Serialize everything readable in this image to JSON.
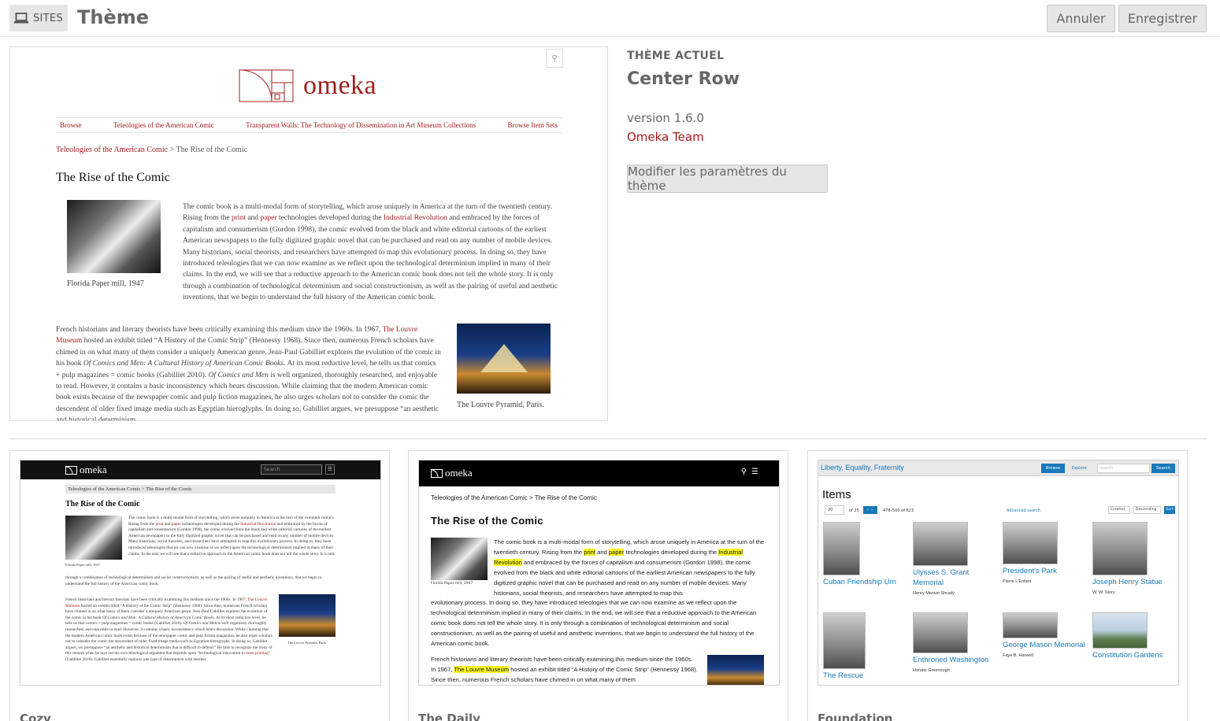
{
  "header": {
    "sites_label": "SITES",
    "title": "Thème",
    "cancel_label": "Annuler",
    "save_label": "Enregistrer"
  },
  "current_theme": {
    "section_label": "THÈME ACTUEL",
    "name": "Center Row",
    "version": "version 1.6.0",
    "author": "Omeka Team",
    "configure_label": "Modifier les paramètres du thème",
    "preview": {
      "logo_text": "omeka",
      "nav": [
        "Browse",
        "Teleologies of the American Comic",
        "Transparent Walls: The Technology of Dissemination in Art Museum Collections",
        "Browse Item Sets"
      ],
      "breadcrumb_link": "Teleologies of the American Comic",
      "breadcrumb_rest": " > The Rise of the Comic",
      "heading": "The Rise of the Comic",
      "caption1": "Florida Paper mill, 1947",
      "caption2": "The Louvre Pyramid, Paris."
    }
  },
  "themes": [
    {
      "name": "Cozy",
      "logo": "omeka",
      "search_placeholder": "Search",
      "breadcrumb": "Teleologies of the American Comic > The Rise of the Comic",
      "heading": "The Rise of the Comic",
      "caption1": "Florida Paper mill, 1947",
      "caption2": "The Louvre Pyramid, Paris."
    },
    {
      "name": "The Daily",
      "logo": "omeka",
      "breadcrumb": "Teleologies of the American Comic > The Rise of the Comic",
      "heading": "The Rise of the Comic",
      "caption1": "Florida Paper mill, 1947"
    },
    {
      "name": "Foundation",
      "site_title": "Liberty, Equality, Fraternity",
      "browse_label": "Browse",
      "explore_label": "Explore",
      "search_placeholder": "Search",
      "search_button": "Search",
      "heading": "Items",
      "page_value": "20",
      "page_of": "of 25",
      "range": "476–500 of 623",
      "advanced_search": "Advanced search",
      "sort_by": "Created",
      "sort_order": "Descending",
      "sort_button": "Sort",
      "items": [
        {
          "title": "Cuban Friendship Urn",
          "creator": ""
        },
        {
          "title": "Ulysses S. Grant Memorial",
          "creator": "Henry Merwin Shrady"
        },
        {
          "title": "President's Park",
          "creator": "Pierre L'Enfant"
        },
        {
          "title": "Joseph Henry Statue",
          "creator": "W. W. Story"
        },
        {
          "title": "The Rescue",
          "creator": ""
        },
        {
          "title": "Enthroned Washington",
          "creator": "Horatio Greenough"
        },
        {
          "title": "George Mason Memorial",
          "creator": "Faye B. Harwell"
        },
        {
          "title": "Constitution Gardens",
          "creator": ""
        }
      ]
    }
  ],
  "colors": {
    "accent_red": "#a91919",
    "foundation_blue": "#1779ba",
    "highlight_yellow": "#f7f322"
  }
}
